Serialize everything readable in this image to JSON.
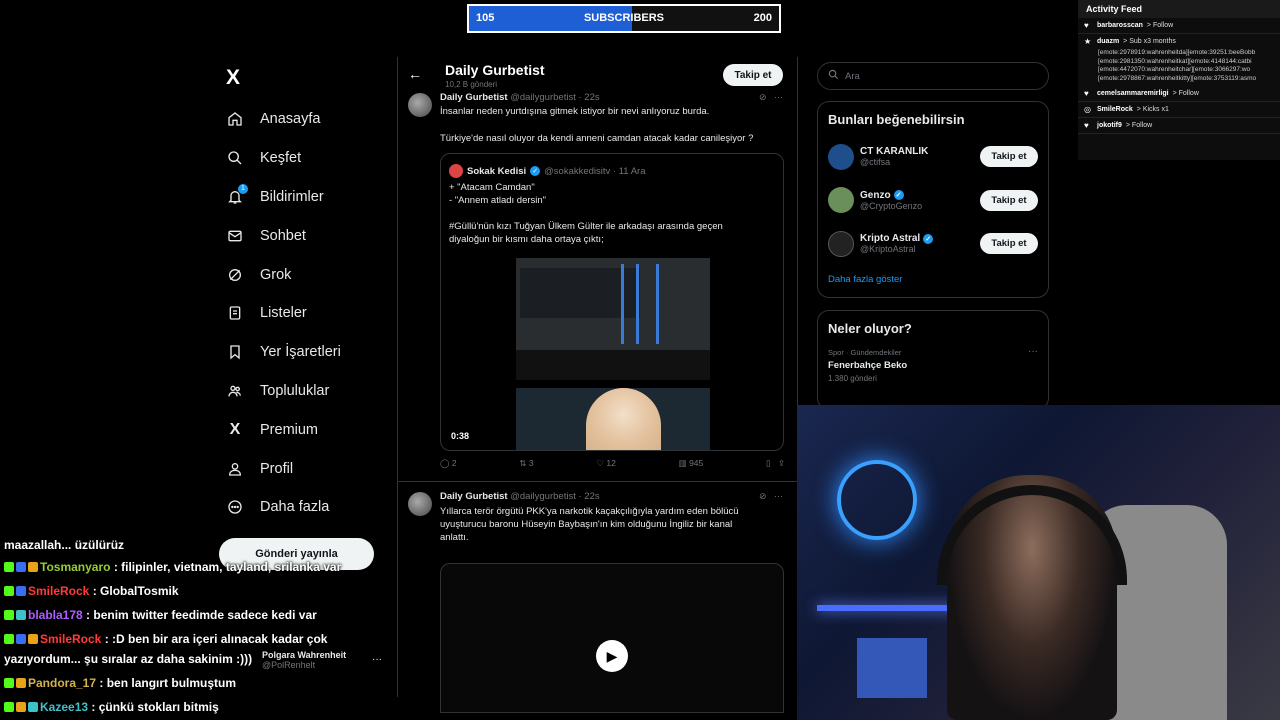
{
  "subscriber_bar": {
    "current": "105",
    "label": "SUBSCRIBERS",
    "goal": "200",
    "progress_percent": 52.5,
    "color": "#1f5fd6"
  },
  "activity_feed": {
    "title": "Activity Feed",
    "events": [
      {
        "user": "barbarosscan",
        "action": "> Follow"
      },
      {
        "user": "duazm",
        "action": "> Sub x3 months"
      },
      {
        "user": "cemelsammaremirligi",
        "action": "> Follow"
      },
      {
        "user": "SmileRock",
        "action": "> Kicks x1"
      },
      {
        "user": "jokotif9",
        "action": "> Follow"
      }
    ],
    "emote_lines": [
      "[emote:2978919:wahrenheitda][emote:39251:beeBobb",
      "[emote:2981350:wahrenheitkat][emote:4148144:catbi",
      "[emote:4472070:wahrenheitchar][emote:3066297:wo",
      "[emote:2978867:wahrenheitkitty][emote:3753119:asmo"
    ]
  },
  "nav": {
    "logo": "X",
    "items": [
      {
        "label": "Anasayfa",
        "icon": "home-icon"
      },
      {
        "label": "Keşfet",
        "icon": "search-icon"
      },
      {
        "label": "Bildirimler",
        "icon": "bell-icon",
        "badge": "1"
      },
      {
        "label": "Sohbet",
        "icon": "mail-icon"
      },
      {
        "label": "Grok",
        "icon": "grok-icon"
      },
      {
        "label": "Listeler",
        "icon": "list-icon"
      },
      {
        "label": "Yer İşaretleri",
        "icon": "bookmark-icon"
      },
      {
        "label": "Topluluklar",
        "icon": "communities-icon"
      },
      {
        "label": "Premium",
        "icon": "x-premium-icon"
      },
      {
        "label": "Profil",
        "icon": "profile-icon"
      },
      {
        "label": "Daha fazla",
        "icon": "more-icon"
      }
    ],
    "post_button": "Gönderi yayınla",
    "account": {
      "name": "Polgara Wahrenheit",
      "handle": "@PolRenhelt"
    }
  },
  "profile_header": {
    "name": "Daily Gurbetist",
    "posts": "10,2 B gönderi",
    "follow": "Takip et"
  },
  "tweets": [
    {
      "name": "Daily Gurbetist",
      "handle": "@dailygurbetist · 22s",
      "text1": "İnsanlar neden yurtdışına gitmek istiyor bir nevi anlıyoruz burda.",
      "text2": "Türkiye'de nasıl oluyor da kendi anneni camdan atacak kadar canileşiyor ?",
      "quote": {
        "name": "Sokak Kedisi",
        "handle": "@sokakkedisitv · 11 Ara",
        "line1": "+ \"Atacam Camdan\"",
        "line2": "- \"Annem atladı dersin\"",
        "line3": "#Güllü'nün kızı Tuğyan Ülkem Gülter ile arkadaşı arasında geçen",
        "line4": "diyaloğun bir kısmı daha ortaya çıktı;",
        "duration": "0:38"
      },
      "stats": {
        "replies": "2",
        "reposts": "3",
        "likes": "12",
        "views": "945"
      }
    },
    {
      "name": "Daily Gurbetist",
      "handle": "@dailygurbetist · 22s",
      "text1": "Yıllarca terör örgütü PKK'ya narkotik kaçakçılığıyla yardım eden bölücü",
      "text2": "uyuşturucu baronu Hüseyin Baybaşın'ın kim olduğunu İngiliz bir kanal",
      "text3": "anlattı."
    }
  ],
  "sidebar": {
    "search_placeholder": "Ara",
    "who_to_follow": {
      "title": "Bunları beğenebilirsin",
      "accounts": [
        {
          "name": "CT KARANLIK",
          "handle": "@ctifsa",
          "verified": false,
          "button": "Takip et",
          "color": "#1e4e8c"
        },
        {
          "name": "Genzo",
          "handle": "@CryptoGenzo",
          "verified": true,
          "button": "Takip et",
          "color": "#6b8f5a"
        },
        {
          "name": "Kripto Astral",
          "handle": "@KriptoAstral",
          "verified": true,
          "button": "Takip et",
          "color": "#222222"
        }
      ],
      "show_more": "Daha fazla göster"
    },
    "trends": {
      "title": "Neler oluyor?",
      "items": [
        {
          "category": "Spor · Gündemdekiler",
          "topic": "Fenerbahçe Beko",
          "count": "1.380 gönderi"
        }
      ]
    }
  },
  "chat": [
    {
      "user": "",
      "text": "maazallah... üzülürüz",
      "color": "#ffffff"
    },
    {
      "user": "Tosmanyaro",
      "text": ": filipinler, vietnam, tayland, srilanka var",
      "color": "#9acd32"
    },
    {
      "user": "SmileRock",
      "text": ": GlobalTosmik",
      "color": "#ff3b3b"
    },
    {
      "user": "blabla178",
      "text": ": benim twitter feedimde sadece kedi var",
      "color": "#b05cff"
    },
    {
      "user": "SmileRock",
      "text": ": :D ben bir ara içeri alınacak kadar çok",
      "color": "#ff3b3b"
    },
    {
      "user": "",
      "text": "yazıyordum... şu sıralar az daha sakinim :)))",
      "color": "#ffffff"
    },
    {
      "user": "Pandora_17",
      "text": ": ben langırt bulmuştum",
      "color": "#d4b24c"
    },
    {
      "user": "Kazee13",
      "text": ": çünkü stokları bitmiş",
      "color": "#3fc1c9"
    }
  ]
}
